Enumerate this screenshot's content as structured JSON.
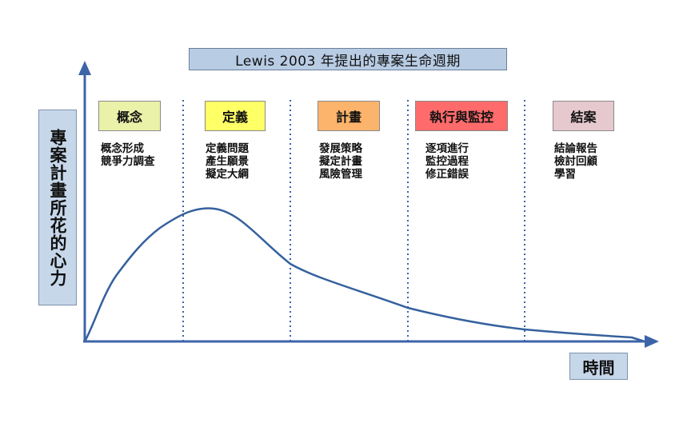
{
  "title": "Lewis  2003 年提出的專案生命週期",
  "y_axis_label": "專案計畫所花的心力",
  "x_axis_label": "時間",
  "colors": {
    "axis": "#3d64a8",
    "curve": "#35619e",
    "divider": "#3d64a8",
    "title_bg": "#b8cce4",
    "label_bg": "#c7d7ea"
  },
  "phases": [
    {
      "label": "概念",
      "color": "#eaf1a8",
      "tasks": [
        "概念形成",
        "競爭力調查"
      ]
    },
    {
      "label": "定義",
      "color": "#ffff66",
      "tasks": [
        "定義問題",
        "產生願景",
        "擬定大綱"
      ]
    },
    {
      "label": "計畫",
      "color": "#fcb46c",
      "tasks": [
        "發展策略",
        "擬定計畫",
        "風險管理"
      ]
    },
    {
      "label": "執行與監控",
      "color": "#ff6b6b",
      "tasks": [
        "逐項進行",
        "監控過程",
        "修正錯誤"
      ]
    },
    {
      "label": "結案",
      "color": "#e6c9cf",
      "tasks": [
        "結論報告",
        "檢討回顧",
        "學習"
      ]
    }
  ]
}
